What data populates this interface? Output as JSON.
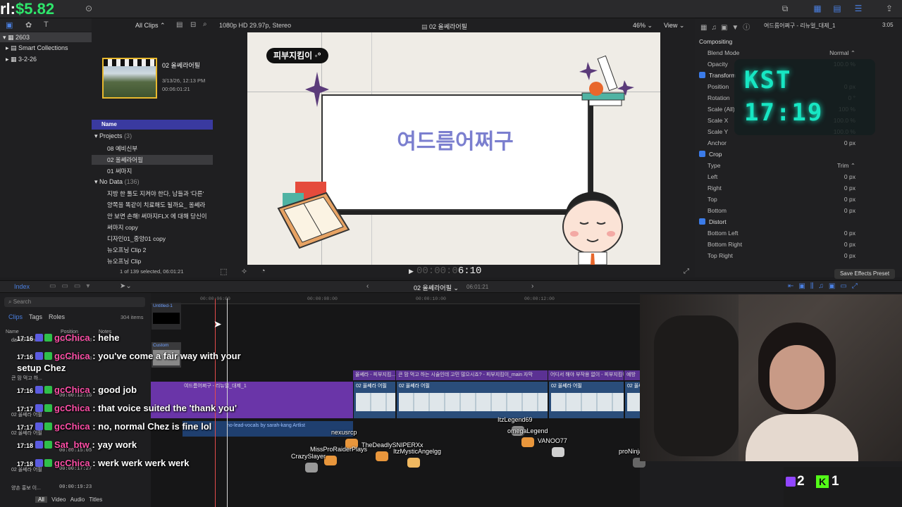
{
  "money": {
    "prefix": "rl:",
    "amount": "$5.82"
  },
  "library": {
    "root": "2603",
    "items": [
      {
        "label": "Smart Collections"
      },
      {
        "label": "3-2-26"
      }
    ]
  },
  "browser": {
    "filter": "All Clips",
    "clip_name": "02 올쎄라어필",
    "clip_date": "3/13/26, 12:13 PM",
    "clip_duration": "00:06:01:21",
    "name_header": "Name",
    "projects_label": "Projects",
    "projects_count": "(3)",
    "projects": [
      "08 예비신부",
      "02 올쎄라어필",
      "01 써마지"
    ],
    "nodata_label": "No Data",
    "nodata_count": "(136)",
    "nodata": [
      "지방 한 톨도 지켜야 한다, 남들과 '다른'",
      "양쪽을 똑같이 치료해도 될까요_ 올쎄라",
      "안 보면 손해! 써마지FLX 에 대해 당신이",
      "써마지 copy",
      "디자인01_중앙01 copy",
      "뉴오프닝 Clip 2",
      "뉴오프닝 Clip"
    ],
    "status": "1 of 139 selected, 06:01:21"
  },
  "viewer": {
    "format": "1080p HD 29.97p, Stereo",
    "title": "02 올쎄라어필",
    "zoom": "46%",
    "view": "View",
    "tag": "피부지킴이 ◦°",
    "card_title": "여드름어쩌구",
    "timecode_dim": "00:00:0",
    "timecode": "6:10"
  },
  "inspector": {
    "title": "여드름어쩌구 - 리뉴얼_대제_1",
    "duration": "3:05",
    "rows": [
      {
        "label": "Compositing",
        "value": ""
      },
      {
        "label": "Blend Mode",
        "value": "Normal ⌃"
      },
      {
        "label": "Opacity",
        "value": "100.0 %"
      },
      {
        "label": "Transform",
        "value": ""
      },
      {
        "label": "Position",
        "value": "0 px"
      },
      {
        "label": "Rotation",
        "value": "0 °"
      },
      {
        "label": "Scale (All)",
        "value": "100 %"
      },
      {
        "label": "Scale X",
        "value": "100.0 %"
      },
      {
        "label": "Scale Y",
        "value": "100.0 %"
      },
      {
        "label": "Anchor",
        "value": "0 px"
      },
      {
        "label": "Crop",
        "value": ""
      },
      {
        "label": "Type",
        "value": "Trim ⌃"
      },
      {
        "label": "Left",
        "value": "0 px"
      },
      {
        "label": "Right",
        "value": "0 px"
      },
      {
        "label": "Top",
        "value": "0 px"
      },
      {
        "label": "Bottom",
        "value": "0 px"
      },
      {
        "label": "Distort",
        "value": ""
      },
      {
        "label": "Bottom Left",
        "value": "0 px"
      },
      {
        "label": "Bottom Right",
        "value": "0 px"
      },
      {
        "label": "Top Right",
        "value": "0 px"
      }
    ],
    "save_preset": "Save Effects Preset"
  },
  "overlay_clock": {
    "label": "KST",
    "time": "17:19"
  },
  "timeline_bar": {
    "index": "Index",
    "project": "02 올쎄라어필",
    "duration": "06:01:21"
  },
  "index_panel": {
    "search_placeholder": "Search",
    "tabs": [
      "Clips",
      "Tags",
      "Roles"
    ],
    "items_count": "304 items",
    "columns": [
      "Name",
      "Position",
      "Notes"
    ],
    "bottom_tabs": [
      "All",
      "Video",
      "Audio",
      "Titles"
    ],
    "rows": [
      {
        "name": "dance-with...",
        "pos": "00:00:05:23"
      },
      {
        "name": "",
        "pos": "00:00:08:28"
      },
      {
        "name": "큰 맘 먹고 하...",
        "pos": ""
      },
      {
        "name": "",
        "pos": "00:00:12:16"
      },
      {
        "name": "02 올쎄라 어필",
        "pos": ""
      },
      {
        "name": "02 올쎄라 어필",
        "pos": ""
      },
      {
        "name": "",
        "pos": "00:00:15:05"
      },
      {
        "name": "02 올쎄라 어필",
        "pos": "00:00:17:27"
      },
      {
        "name": "양손 홍보 이...",
        "pos": "00:00:19:23"
      }
    ]
  },
  "timeline": {
    "ruler": [
      "00:00:06:00",
      "00:00:08:00",
      "00:00:10:00",
      "00:00:12:00"
    ],
    "untitled": "Untitled-1",
    "custom": "Custom",
    "title_clips": [
      "올쎄라 - 피부지킴...",
      "큰 맘 먹고 하는 시술인데 고민 많으시죠? - 피부지킴이_main 자막",
      "어디서 해야 부작용 없이 - 피부지킴이...",
      "예방"
    ],
    "video_clips": [
      "02 올쎄라 어필",
      "02 올쎄라 어필",
      "02 올쎄라 어필",
      "02 올쎄라 어필"
    ],
    "purple_clip": "여드름어쩌구 - 리뉴얼_대제_1",
    "audio_clip": "no-lead-vocals by sarah-kang Artlist"
  },
  "chat": [
    {
      "time": "17:16",
      "user": "gcChica",
      "msg": "hehe"
    },
    {
      "time": "17:16",
      "user": "gcChica",
      "msg": "you've come a fair way with your setup Chez"
    },
    {
      "time": "17:16",
      "user": "gcChica",
      "msg": "good job"
    },
    {
      "time": "17:17",
      "user": "gcChica",
      "msg": "that voice suited the 'thank you'"
    },
    {
      "time": "17:17",
      "user": "gcChica",
      "msg": "no, normal Chez is fine lol"
    },
    {
      "time": "17:18",
      "user": "Sat_btw",
      "msg": "yay work"
    },
    {
      "time": "17:18",
      "user": "gcChica",
      "msg": "werk werk werk werk"
    }
  ],
  "viewers": [
    "nexusrcp",
    "ItzLegend69",
    "omegaLegend",
    "VANOO77",
    "MissProRaiderPlays",
    "TheDeadlySNIPERXx",
    "ItzMysticAngelgg",
    "CrazySlayer",
    "proNinja"
  ],
  "counters": {
    "twitch": "2",
    "kick": "1"
  },
  "colors": {
    "accent": "#3b7be8",
    "chat_user": "#ff4fa8",
    "clock": "#17e6c3",
    "money": "#2ee66b",
    "selection": "#e9b92e"
  }
}
